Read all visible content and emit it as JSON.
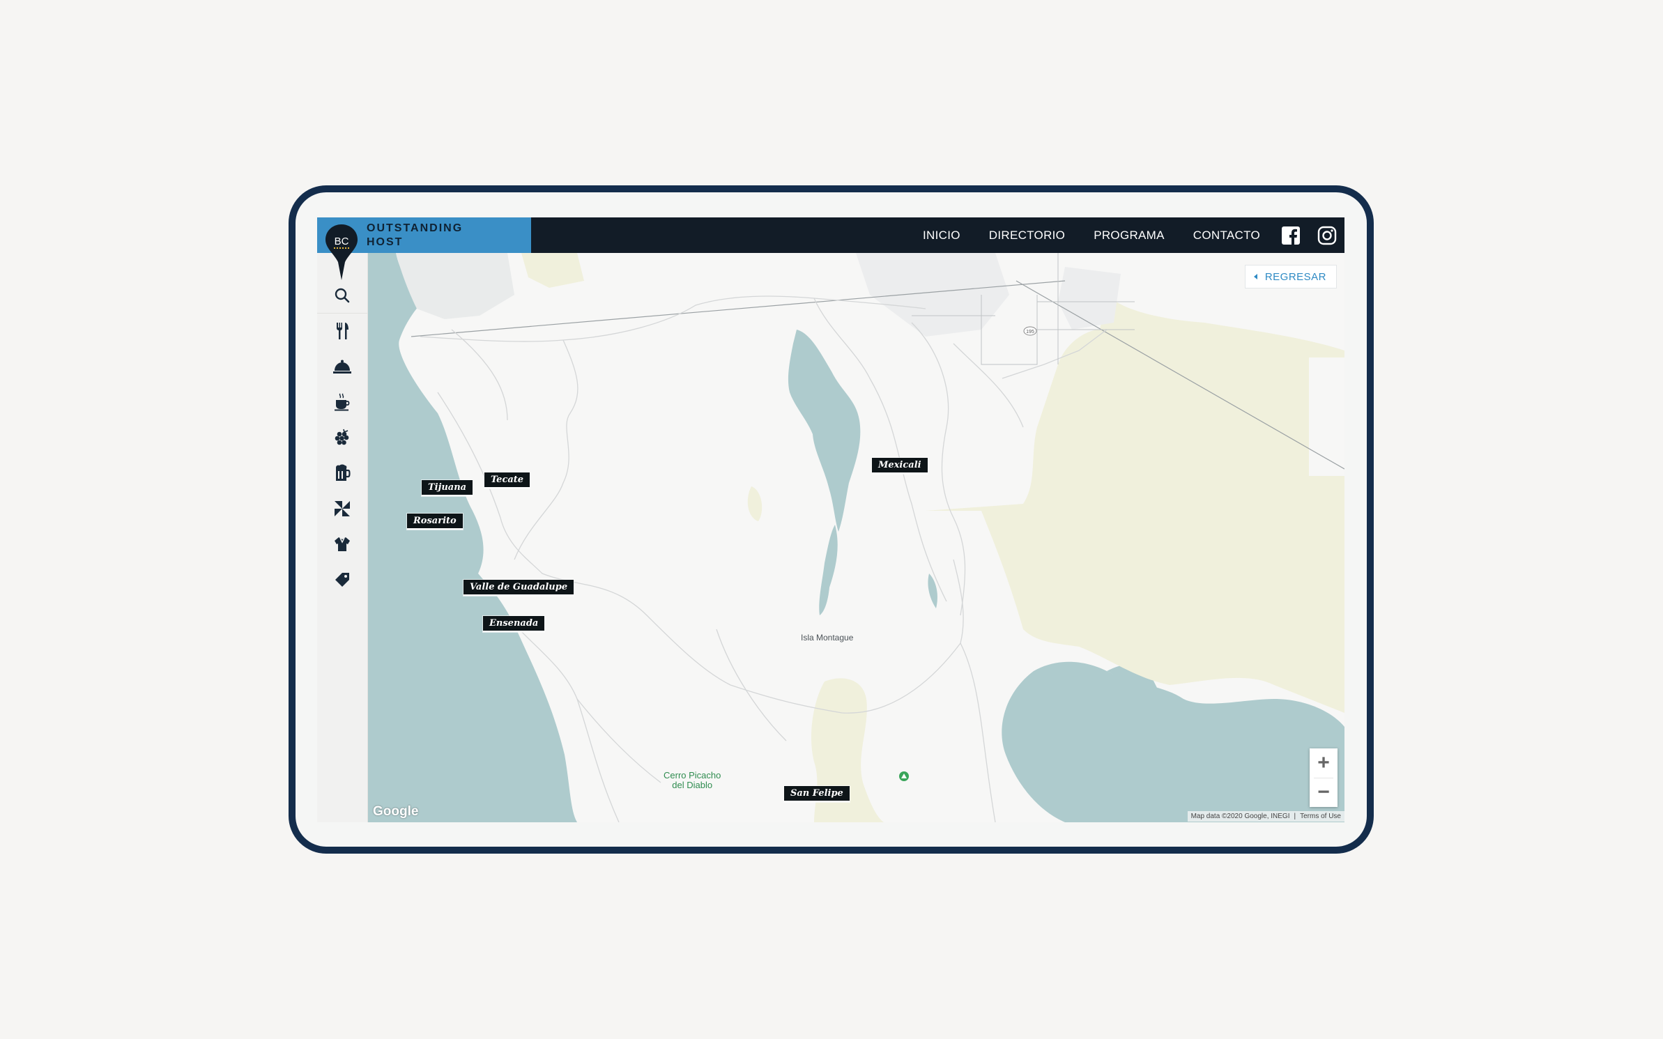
{
  "brand": {
    "line1": "OUTSTANDING",
    "line2": "HOST",
    "logo_text": "BC"
  },
  "nav": {
    "items": [
      {
        "label": "INICIO"
      },
      {
        "label": "DIRECTORIO"
      },
      {
        "label": "PROGRAMA"
      },
      {
        "label": "CONTACTO"
      }
    ],
    "social": [
      "facebook-icon",
      "instagram-icon"
    ]
  },
  "sidebar": {
    "items": [
      "search-icon",
      "restaurant-icon",
      "hotel-icon",
      "coffee-icon",
      "wine-icon",
      "beer-icon",
      "spa-icon",
      "shirt-icon",
      "tag-icon"
    ]
  },
  "map": {
    "back_label": "REGRESAR",
    "cities": [
      "Mexicali",
      "Tijuana",
      "Tecate",
      "Rosarito",
      "Valle de Guadalupe",
      "Ensenada",
      "San Felipe"
    ],
    "places": {
      "isla": "Isla Montague",
      "peak_line1": "Cerro Picacho",
      "peak_line2": "del Diablo",
      "route_shield": "195"
    },
    "zoom_in": "+",
    "zoom_out": "−",
    "provider": "Google",
    "attribution": "Map data ©2020 Google, INEGI",
    "terms": "Terms of Use"
  },
  "colors": {
    "topbar": "#121c27",
    "brand": "#3a8fc6",
    "water": "#aecbcd",
    "park": "#f0f0dc",
    "frame": "#142d4c"
  }
}
